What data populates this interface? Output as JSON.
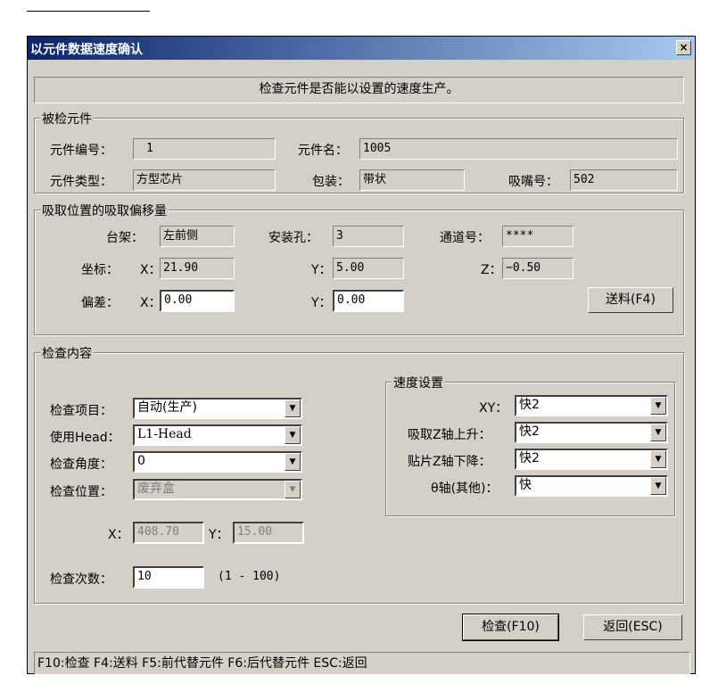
{
  "window": {
    "title": "以元件数据速度确认",
    "close": "×"
  },
  "info_text": "检查元件是否能以设置的速度生产。",
  "component": {
    "group": "被检元件",
    "no_label": "元件编号：",
    "no_value": "1",
    "name_label": "元件名：",
    "name_value": "1005",
    "type_label": "元件类型：",
    "type_value": "方型芯片",
    "pack_label": "包装：",
    "pack_value": "带状",
    "nozzle_label": "吸嘴号：",
    "nozzle_value": "502"
  },
  "pickup": {
    "group": "吸取位置的吸取偏移量",
    "stage_label": "台架：",
    "stage_value": "左前侧",
    "hole_label": "安装孔：",
    "hole_value": "3",
    "channel_label": "通道号：",
    "channel_value": "****",
    "coord_label": "坐标：",
    "x_label": "X：",
    "x_value": "21.90",
    "y_label": "Y：",
    "y_value": "5.00",
    "z_label": "Z：",
    "z_value": "−0.50",
    "dev_label": "偏差：",
    "dx_label": "X：",
    "dx_value": "0.00",
    "dy_label": "Y：",
    "dy_value": "0.00",
    "feed_button": "送料(F4)"
  },
  "check": {
    "group": "检查内容",
    "item_label": "检查项目：",
    "item_value": "自动(生产)",
    "head_label": "使用Head：",
    "head_value": "L1-Head",
    "angle_label": "检查角度：",
    "angle_value": "0",
    "pos_label": "检查位置：",
    "pos_value": "废弃盒",
    "x_label": "X：",
    "x_value": "408.70",
    "y_label": "Y：",
    "y_value": "15.00",
    "count_label": "检查次数：",
    "count_value": "10",
    "count_range": "(1 - 100)"
  },
  "speed": {
    "group": "速度设置",
    "xy_label": "XY：",
    "xy_value": "快2",
    "zup_label": "吸取Z轴上升：",
    "zup_value": "快2",
    "zdown_label": "贴片Z轴下降：",
    "zdown_value": "快2",
    "theta_label": "θ轴(其他)：",
    "theta_value": "快"
  },
  "buttons": {
    "check": "检查(F10)",
    "back": "返回(ESC)"
  },
  "status": "F10:检查  F4:送料  F5:前代替元件  F6:后代替元件  ESC:返回"
}
